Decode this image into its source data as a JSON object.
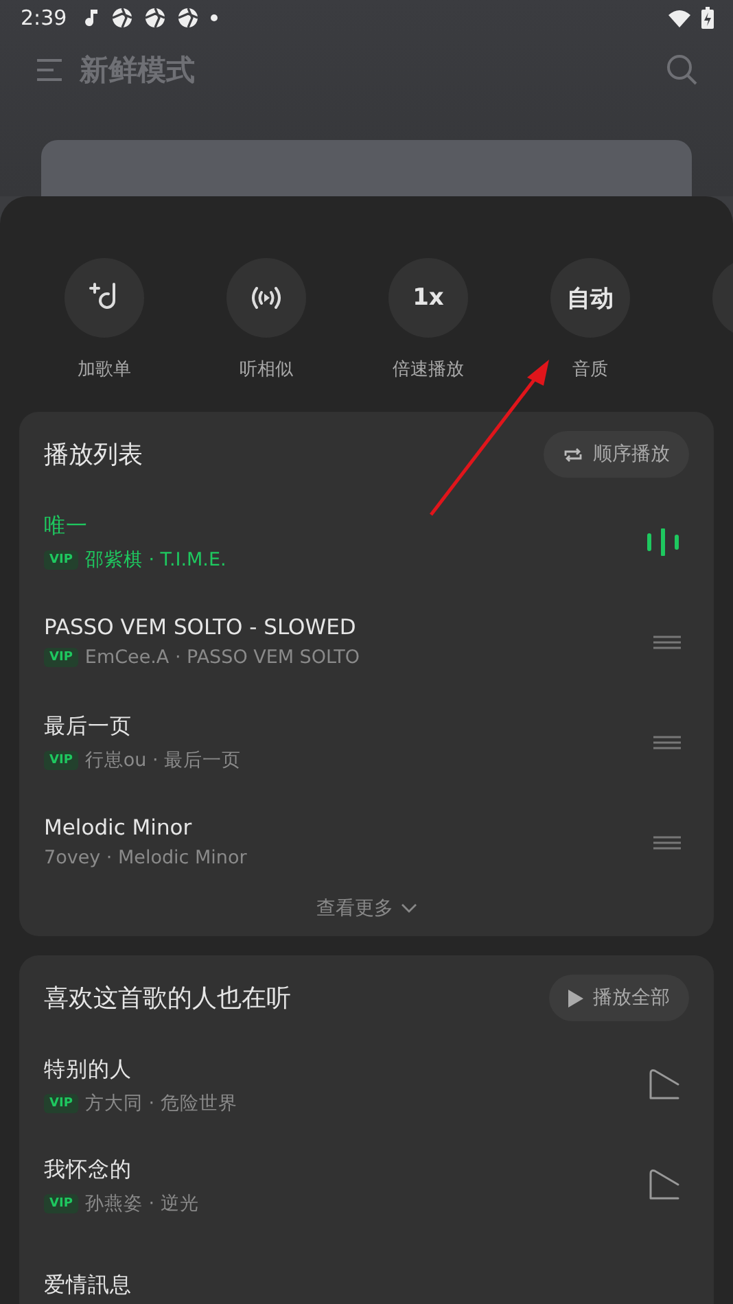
{
  "status_bar": {
    "time": "2:39"
  },
  "header": {
    "title": "新鲜模式"
  },
  "actions": [
    {
      "kind": "add-playlist",
      "label": "加歌单"
    },
    {
      "kind": "similar",
      "label": "听相似"
    },
    {
      "kind": "text",
      "text": "1x",
      "label": "倍速播放"
    },
    {
      "kind": "text",
      "text": "自动",
      "label": "音质"
    }
  ],
  "playlist": {
    "title": "播放列表",
    "mode_button": "顺序播放",
    "more": "查看更多",
    "songs": [
      {
        "title": "唯一",
        "subtitle": "邵紫棋 · T.I.M.E.",
        "badge": "VIP",
        "selected": true
      },
      {
        "title": "PASSO VEM SOLTO - SLOWED",
        "subtitle": "EmCee.A · PASSO VEM SOLTO",
        "badge": "VIP",
        "selected": false
      },
      {
        "title": "最后一页",
        "subtitle": "行崽ou · 最后一页",
        "badge": "VIP",
        "selected": false
      },
      {
        "title": "Melodic Minor",
        "subtitle": "7ovey · Melodic Minor",
        "selected": false
      }
    ]
  },
  "recommend": {
    "title": "喜欢这首歌的人也在听",
    "play_all": "播放全部",
    "songs": [
      {
        "title": "特别的人",
        "subtitle": "方大同 · 危险世界",
        "badge": "VIP"
      },
      {
        "title": "我怀念的",
        "subtitle": "孙燕姿 · 逆光",
        "badge": "VIP"
      },
      {
        "title": "爱情訊息"
      }
    ]
  }
}
